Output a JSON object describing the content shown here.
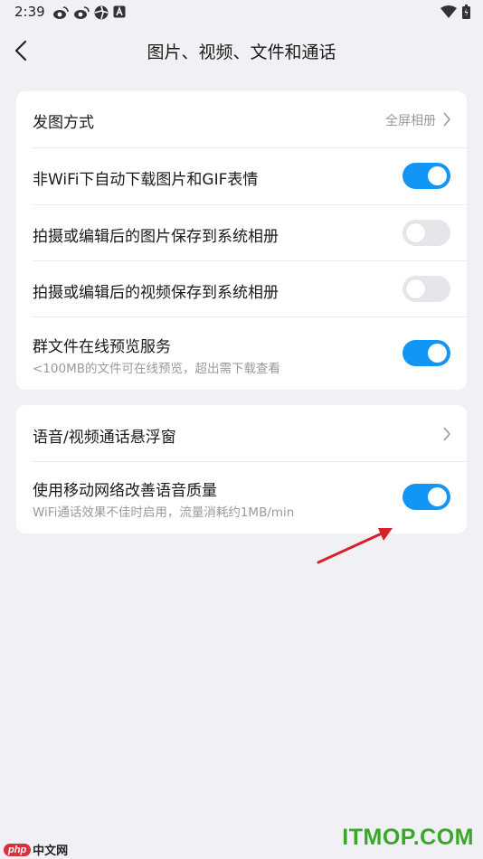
{
  "status_bar": {
    "time": "2:39",
    "left_icons": [
      "weibo-icon",
      "weibo-icon",
      "aperture-icon",
      "font-a-icon"
    ],
    "right_icons": [
      "wifi-icon",
      "battery-icon"
    ]
  },
  "header": {
    "title": "图片、视频、文件和通话"
  },
  "group1": {
    "photo_mode": {
      "label": "发图方式",
      "value": "全屏相册"
    },
    "auto_download": {
      "label": "非WiFi下自动下载图片和GIF表情",
      "enabled": true
    },
    "save_photos": {
      "label": "拍摄或编辑后的图片保存到系统相册",
      "enabled": false
    },
    "save_videos": {
      "label": "拍摄或编辑后的视频保存到系统相册",
      "enabled": false
    },
    "file_preview": {
      "label": "群文件在线预览服务",
      "sub": "<100MB的文件可在线预览，超出需下载查看",
      "enabled": true
    }
  },
  "group2": {
    "float_window": {
      "label": "语音/视频通话悬浮窗"
    },
    "mobile_network": {
      "label": "使用移动网络改善语音质量",
      "sub": "WiFi通话效果不佳时启用，流量消耗约1MB/min",
      "enabled": true
    }
  },
  "colors": {
    "accent": "#1296f5",
    "annotation_arrow": "#d8202a",
    "background": "#f1f1f5"
  },
  "watermarks": {
    "left_badge": "php",
    "left_text": "中文网",
    "right_text": "ITMOP.COM"
  }
}
